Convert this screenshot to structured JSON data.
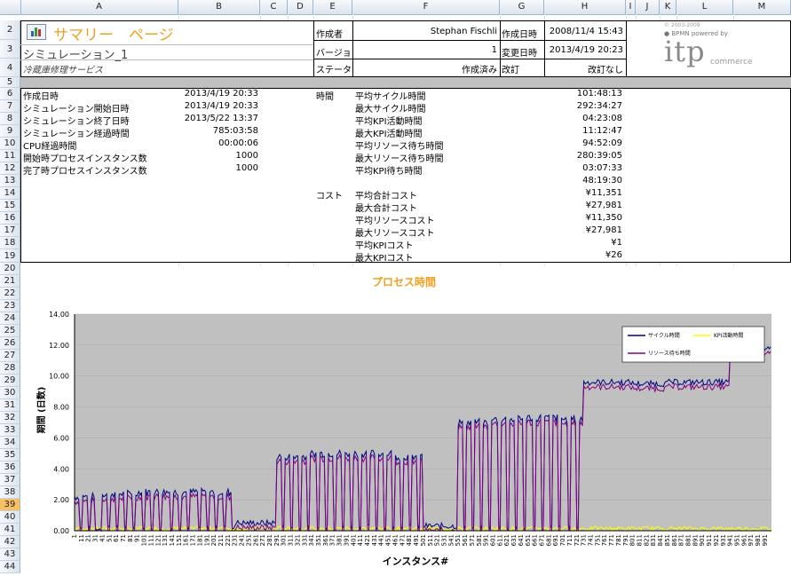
{
  "columns": [
    "A",
    "B",
    "C",
    "D",
    "E",
    "F",
    "G",
    "H",
    "I",
    "J",
    "K",
    "L",
    "M"
  ],
  "rows": [
    "2",
    "3",
    "4",
    "5",
    "6",
    "7",
    "8",
    "9",
    "10",
    "11",
    "12",
    "13",
    "14",
    "15",
    "16",
    "17",
    "18",
    "19",
    "20",
    "21",
    "22",
    "23",
    "24",
    "25",
    "26",
    "27",
    "28",
    "29",
    "30",
    "31",
    "32",
    "33",
    "34",
    "35",
    "36",
    "37",
    "38",
    "39",
    "40",
    "41",
    "42",
    "43",
    "44"
  ],
  "selected_row": "39",
  "header": {
    "page_title": "サマリー　ページ",
    "simulation_name": "シミュレーション_1",
    "service_name": "冷蔵庫修理サービス",
    "creator_label": "作成者",
    "creator_value": "Stephan Fischli",
    "created_label": "作成日時",
    "created_value": "2008/11/4 15:43",
    "version_label": "バージョ",
    "version_value": "1",
    "modified_label": "変更日時",
    "modified_value": "2013/4/19 20:23",
    "status_label": "ステータ",
    "status_value": "作成済み",
    "revision_label": "改訂",
    "revision_value": "改訂なし"
  },
  "logo": {
    "copyright": "© 2003-2009",
    "bpmn": "● BPMN powered by",
    "brand": "itp",
    "sub": "commerce"
  },
  "stats_left": [
    {
      "label": "作成日時",
      "value": "2013/4/19 20:33"
    },
    {
      "label": "シミュレーション開始日時",
      "value": "2013/4/19 20:33"
    },
    {
      "label": "シミュレーション終了日時",
      "value": "2013/5/22 13:37"
    },
    {
      "label": "シミュレーション経過時間",
      "value": "785:03:58"
    },
    {
      "label": "CPU経過時間",
      "value": "00:00:06"
    },
    {
      "label": "開始時プロセスインスタンス数",
      "value": "1000"
    },
    {
      "label": "完了時プロセスインスタンス数",
      "value": "1000"
    }
  ],
  "time_section": "時間",
  "cost_section": "コスト",
  "stats_right": [
    {
      "label": "平均サイクル時間",
      "value": "101:48:13"
    },
    {
      "label": "最大サイクル時間",
      "value": "292:34:27"
    },
    {
      "label": "平均KPI活動時間",
      "value": "04:23:08"
    },
    {
      "label": "最大KPI活動時間",
      "value": "11:12:47"
    },
    {
      "label": "平均リソース待ち時間",
      "value": "94:52:09"
    },
    {
      "label": "最大リソース待ち時間",
      "value": "280:39:05"
    },
    {
      "label": "平均KPI待ち時間",
      "value": "03:07:33"
    },
    {
      "label": "",
      "value": "48:19:30"
    },
    {
      "label": "平均合計コスト",
      "value": "¥11,351"
    },
    {
      "label": "最大合計コスト",
      "value": "¥27,981"
    },
    {
      "label": "平均リソースコスト",
      "value": "¥11,350"
    },
    {
      "label": "最大リソースコスト",
      "value": "¥27,981"
    },
    {
      "label": "平均KPIコスト",
      "value": "¥1"
    },
    {
      "label": "最大KPIコスト",
      "value": "¥26"
    }
  ],
  "colors": {
    "title_orange": "#f0a020",
    "plot_bg": "#c0c0c0",
    "cycle": "#000080",
    "kpi": "#ffff00",
    "wait": "#800080",
    "section_bar": "#c0c0c0"
  },
  "chart_data": {
    "type": "line",
    "title": "プロセス時間",
    "xlabel": "インスタンス#",
    "ylabel": "期間 (日数)",
    "ylim": [
      0,
      14
    ],
    "yticks": [
      "0.00",
      "2.00",
      "4.00",
      "6.00",
      "8.00",
      "10.00",
      "12.00",
      "14.00"
    ],
    "x_tick_labels": [
      "1",
      "11",
      "21",
      "31",
      "41",
      "51",
      "61",
      "71",
      "81",
      "91",
      "101",
      "111",
      "121",
      "131",
      "141",
      "151",
      "161",
      "171",
      "181",
      "191",
      "201",
      "211",
      "221",
      "231",
      "241",
      "251",
      "261",
      "271",
      "281",
      "291",
      "301",
      "311",
      "321",
      "331",
      "341",
      "351",
      "361",
      "371",
      "381",
      "391",
      "401",
      "411",
      "421",
      "431",
      "441",
      "451",
      "461",
      "471",
      "481",
      "491",
      "501",
      "511",
      "521",
      "531",
      "541",
      "551",
      "561",
      "571",
      "581",
      "591",
      "601",
      "611",
      "621",
      "631",
      "641",
      "651",
      "661",
      "671",
      "681",
      "691",
      "701",
      "711",
      "721",
      "731",
      "741",
      "751",
      "761",
      "771",
      "781",
      "791",
      "801",
      "811",
      "821",
      "831",
      "841",
      "851",
      "861",
      "871",
      "881",
      "891",
      "901",
      "911",
      "921",
      "931",
      "941",
      "951",
      "961",
      "971",
      "981",
      "991"
    ],
    "grid": true,
    "legend_position": "top-right",
    "series": [
      {
        "name": "サイクル時間",
        "color": "#000080",
        "segments": [
          {
            "from": 1,
            "to": 30,
            "level": 2.2
          },
          {
            "from": 31,
            "to": 40,
            "level": 0.1
          },
          {
            "from": 41,
            "to": 90,
            "level": 2.4
          },
          {
            "from": 91,
            "to": 130,
            "level": 2.5
          },
          {
            "from": 131,
            "to": 170,
            "level": 2.5
          },
          {
            "from": 171,
            "to": 230,
            "level": 2.5
          },
          {
            "from": 231,
            "to": 290,
            "level": 0.5
          },
          {
            "from": 291,
            "to": 340,
            "level": 4.8
          },
          {
            "from": 341,
            "to": 400,
            "level": 5.0
          },
          {
            "from": 401,
            "to": 460,
            "level": 5.0
          },
          {
            "from": 461,
            "to": 500,
            "level": 4.8
          },
          {
            "from": 501,
            "to": 550,
            "level": 0.3
          },
          {
            "from": 551,
            "to": 600,
            "level": 7.0
          },
          {
            "from": 601,
            "to": 650,
            "level": 7.2
          },
          {
            "from": 651,
            "to": 700,
            "level": 7.3
          },
          {
            "from": 701,
            "to": 730,
            "level": 7.2
          },
          {
            "from": 731,
            "to": 800,
            "level": 9.6
          },
          {
            "from": 801,
            "to": 850,
            "level": 9.5
          },
          {
            "from": 851,
            "to": 940,
            "level": 9.6
          },
          {
            "from": 941,
            "to": 1000,
            "level": 11.7
          }
        ]
      },
      {
        "name": "KPI活動時間",
        "color": "#ffff00",
        "level": 0.15
      },
      {
        "name": "リソース待ち時間",
        "color": "#800080",
        "offset": -0.3
      }
    ]
  }
}
